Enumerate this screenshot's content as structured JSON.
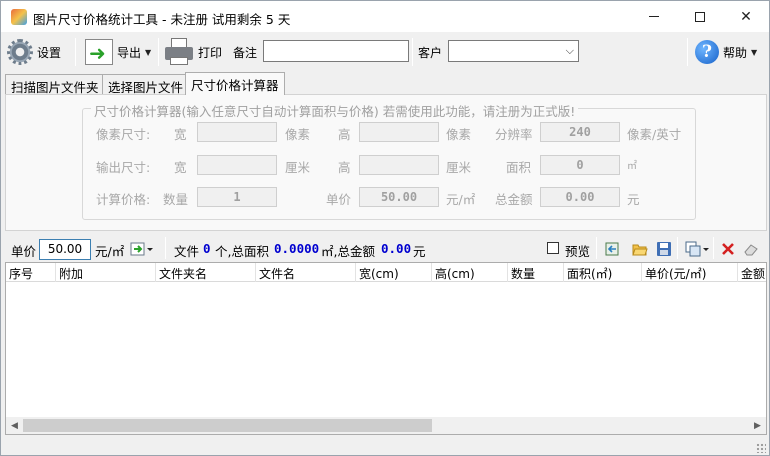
{
  "window": {
    "title": "图片尺寸价格统计工具 - 未注册 试用剩余 5 天",
    "minimize": "",
    "maximize": "",
    "close": "✕"
  },
  "toolbar": {
    "settings_label": "设置",
    "export_label": "导出",
    "print_label": "打印",
    "note_label": "备注",
    "note_value": "",
    "customer_label": "客户",
    "customer_value": "",
    "help_label": "帮助"
  },
  "tabs": [
    {
      "label": "扫描图片文件夹"
    },
    {
      "label": "选择图片文件"
    },
    {
      "label": "尺寸价格计算器"
    }
  ],
  "calculator": {
    "group_title": "尺寸价格计算器(输入任意尺寸自动计算面积与价格)   若需使用此功能，请注册为正式版!",
    "pixel_size_label": "像素尺寸:",
    "width_label": "宽",
    "height_label": "高",
    "pixel_unit": "像素",
    "resolution_label": "分辨率",
    "resolution_value": "240",
    "resolution_unit": "像素/英寸",
    "output_size_label": "输出尺寸:",
    "cm_unit": "厘米",
    "area_label": "面积",
    "area_value": "0",
    "area_unit": "㎡",
    "calc_price_label": "计算价格:",
    "quantity_label": "数量",
    "quantity_value": "1",
    "unit_price_label": "单价",
    "unit_price_value": "50.00",
    "unit_price_unit": "元/㎡",
    "total_label": "总金额",
    "total_value": "0.00",
    "total_unit": "元"
  },
  "summary": {
    "price_label": "单价",
    "price_value": "50.00",
    "price_unit": "元/㎡",
    "files_prefix": "文件",
    "file_count": "0",
    "files_mid": "个,总面积",
    "total_area": "0.0000",
    "area_mid": "㎡,总金额",
    "total_amount": "0.00",
    "currency": "元",
    "preview_label": "预览"
  },
  "table": {
    "columns": [
      "序号",
      "附加",
      "文件夹名",
      "文件名",
      "宽(cm)",
      "高(cm)",
      "数量",
      "面积(㎡)",
      "单价(元/㎡)",
      "金额"
    ]
  },
  "colors": {
    "accent_blue": "#0000d0",
    "delete_red": "#d42020"
  }
}
